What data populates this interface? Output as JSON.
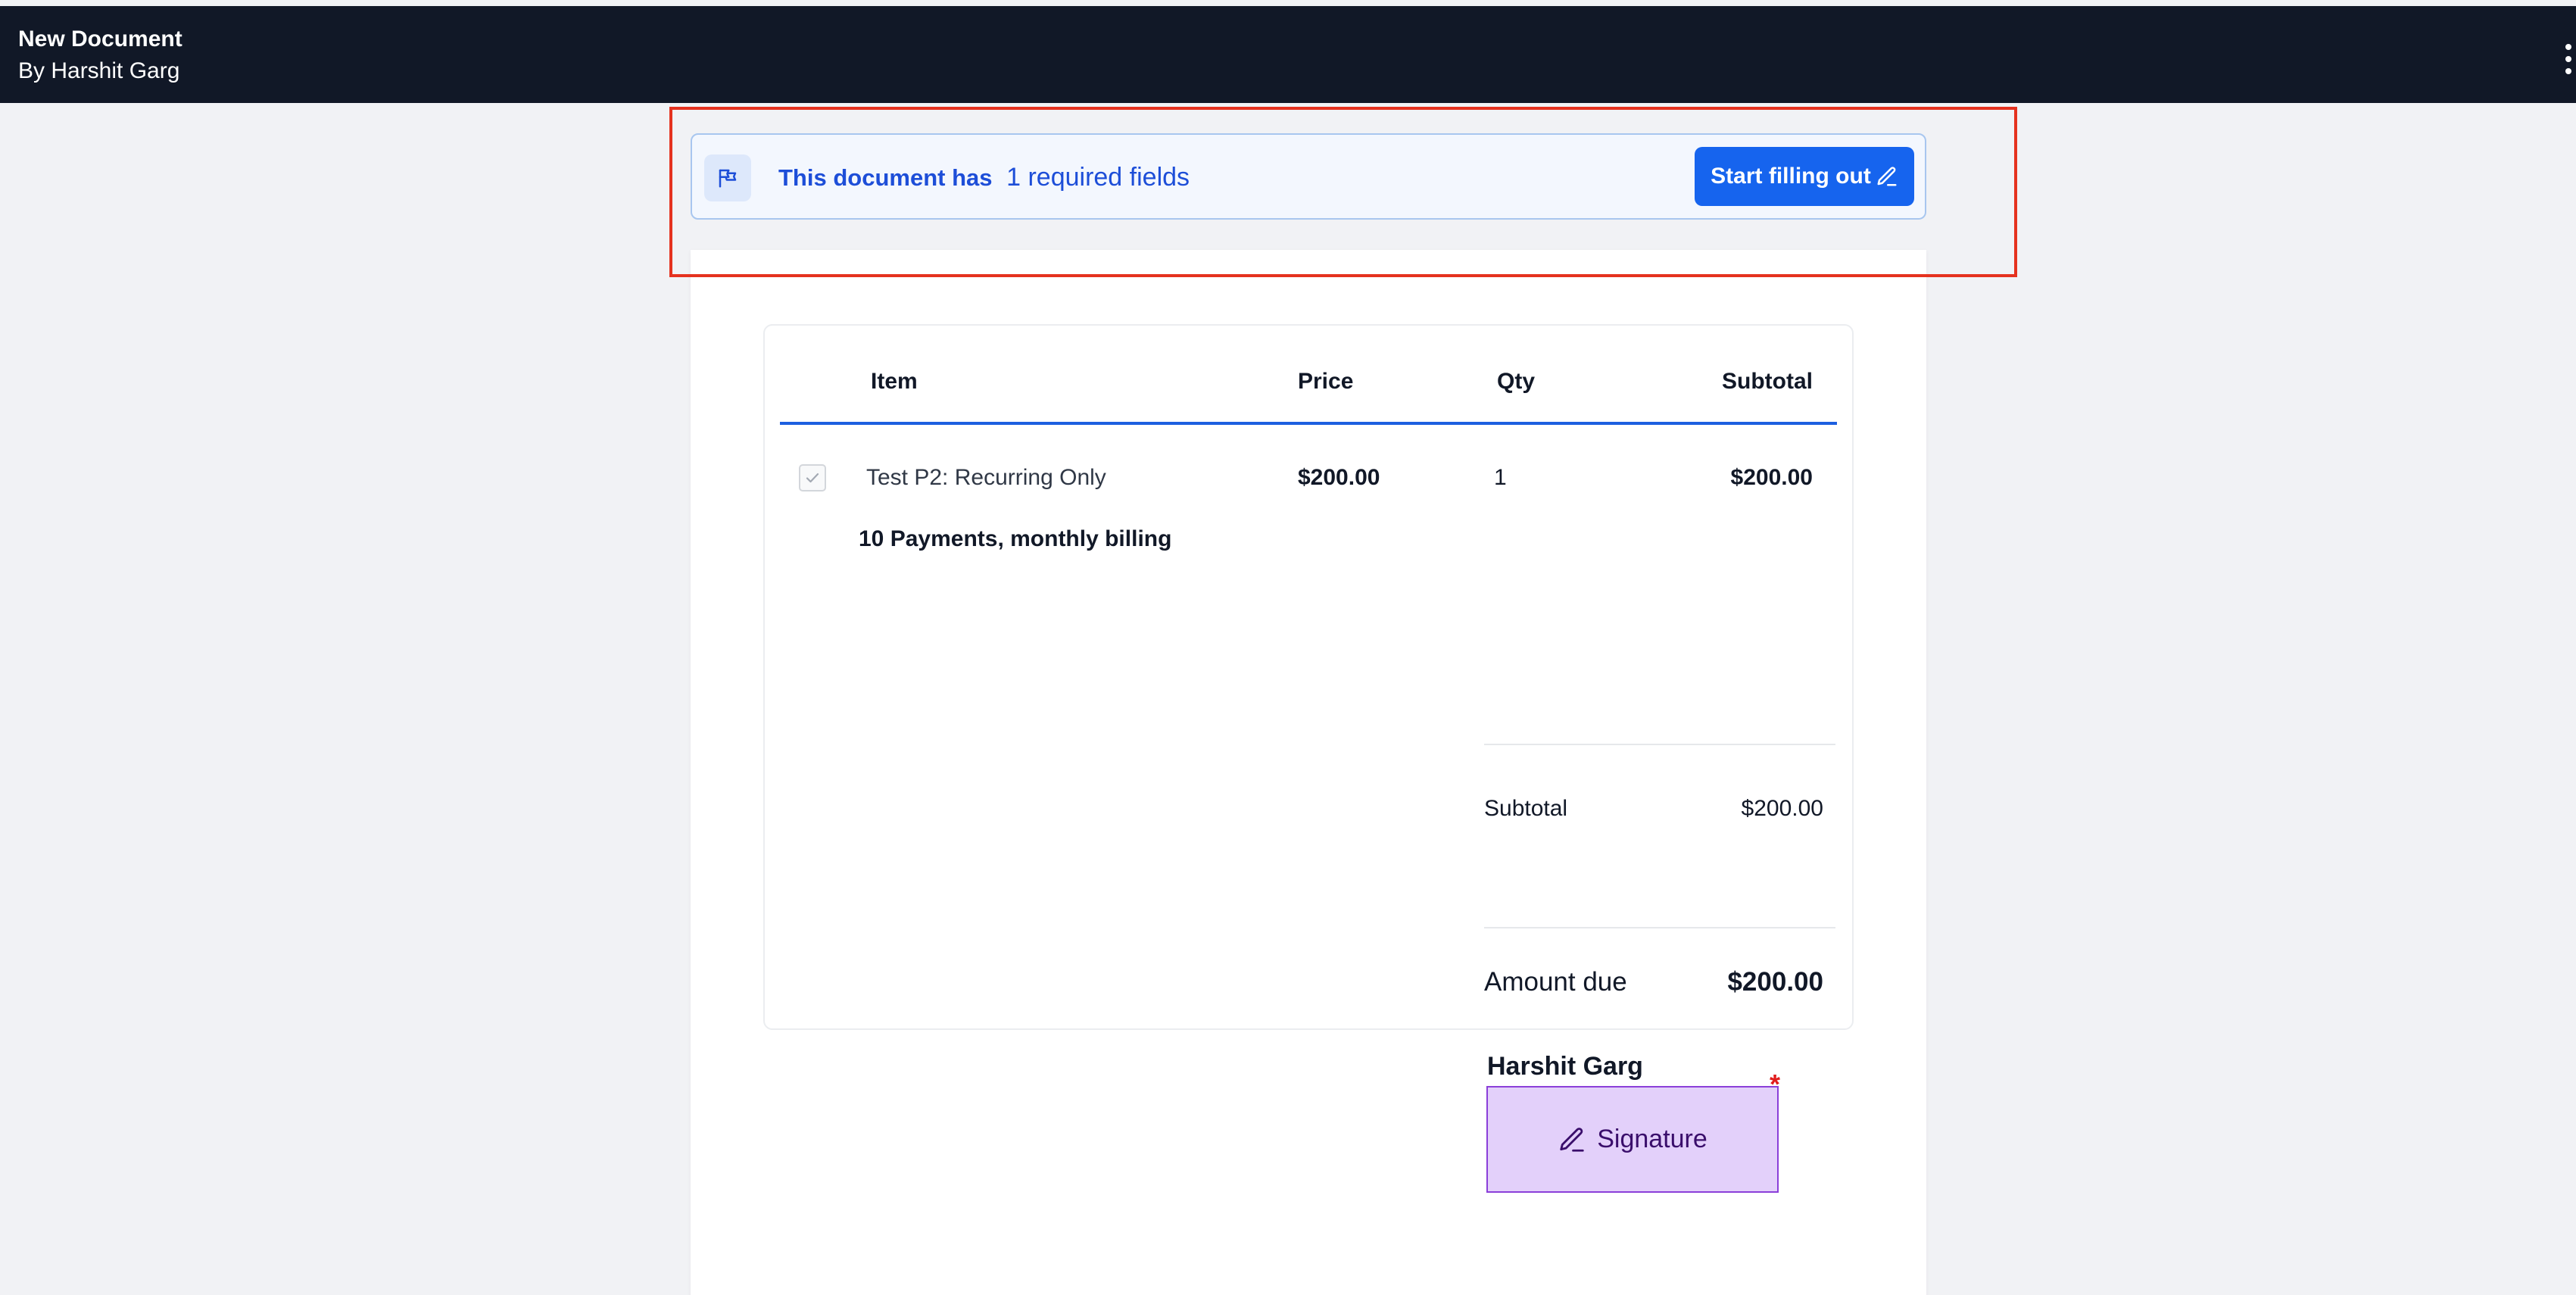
{
  "header": {
    "document_title": "New Document",
    "author_line": "By Harshit Garg",
    "menu_icon": "kebab-menu-icon"
  },
  "banner": {
    "icon": "flag-icon",
    "message_lead": "This document has",
    "required_count_text": "1 required fields",
    "start_button_label": "Start filling out",
    "start_button_icon": "pencil-icon"
  },
  "pricing_table": {
    "columns": [
      "Item",
      "Price",
      "Qty",
      "Subtotal"
    ],
    "rows": [
      {
        "checked": true,
        "name": "Test P2: Recurring Only",
        "price": "$200.00",
        "qty": "1",
        "subtotal": "$200.00",
        "billing": "10 Payments, monthly billing"
      }
    ],
    "summary": {
      "subtotal_label": "Subtotal",
      "subtotal_value": "$200.00",
      "amount_due_label": "Amount due",
      "amount_due_value": "$200.00"
    }
  },
  "signature": {
    "signer_name": "Harshit Garg",
    "field_label": "Signature",
    "required_marker": "*",
    "icon": "pencil-icon"
  },
  "colors": {
    "topbar": "#111827",
    "accent": "#1664ee",
    "banner_bg": "#f3f7fe",
    "highlight_frame": "#e5321f",
    "signature_bg": "#e3d0fa",
    "signature_border": "#8b3fd9",
    "required": "#e11d1d"
  }
}
